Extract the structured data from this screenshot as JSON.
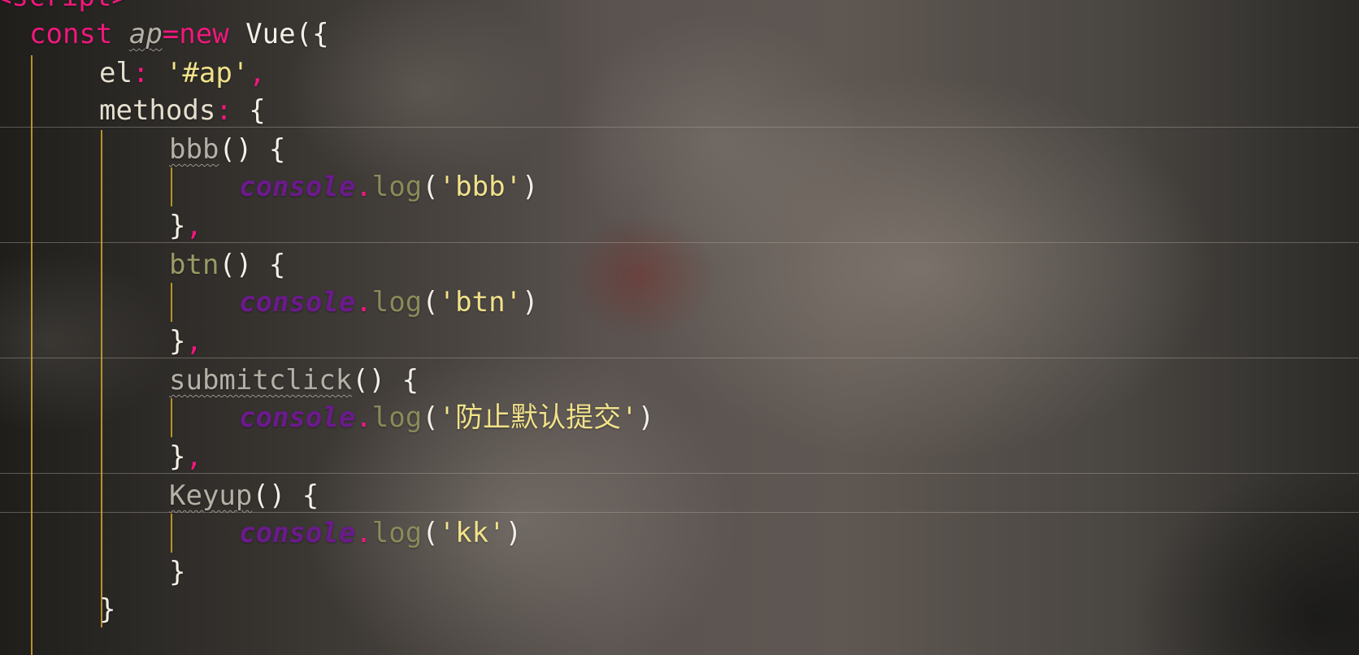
{
  "editor": {
    "line0": {
      "text": "<script>"
    },
    "line1": {
      "kw": "const",
      "var": "ap",
      "eq": "=",
      "kw2": "new",
      "cls": " Vue",
      "open": "({"
    },
    "line2": {
      "prop": "el",
      "colon": ":",
      "str": "'#ap'",
      "comma": ","
    },
    "line3": {
      "prop": "methods",
      "colon": ":",
      "brace": " {"
    },
    "methods": [
      {
        "name": "bbb",
        "sig": "() {",
        "console": "console",
        "dot": ".",
        "log": "log",
        "open": "(",
        "arg": "'bbb'",
        "close": ")",
        "end": "}",
        "sep": ","
      },
      {
        "name": "btn",
        "sig": "() {",
        "console": "console",
        "dot": ".",
        "log": "log",
        "open": "(",
        "arg": "'btn'",
        "close": ")",
        "end": "}",
        "sep": ","
      },
      {
        "name": "submitclick",
        "sig": "() {",
        "console": "console",
        "dot": ".",
        "log": "log",
        "open": "(",
        "arg": "'防止默认提交'",
        "close": ")",
        "end": "}",
        "sep": ","
      },
      {
        "name": "Keyup",
        "sig": "() {",
        "console": "console",
        "dot": ".",
        "log": "log",
        "open": "(",
        "arg": "'kk'",
        "close": ")",
        "end": "}",
        "sep": ""
      }
    ],
    "closing": "}"
  },
  "colors": {
    "keyword": "#f0187c",
    "string": "#f0e28a",
    "console": "#6b1a8c",
    "method_muted": "#8a8a5a",
    "indent_guide": "#b8922a"
  }
}
